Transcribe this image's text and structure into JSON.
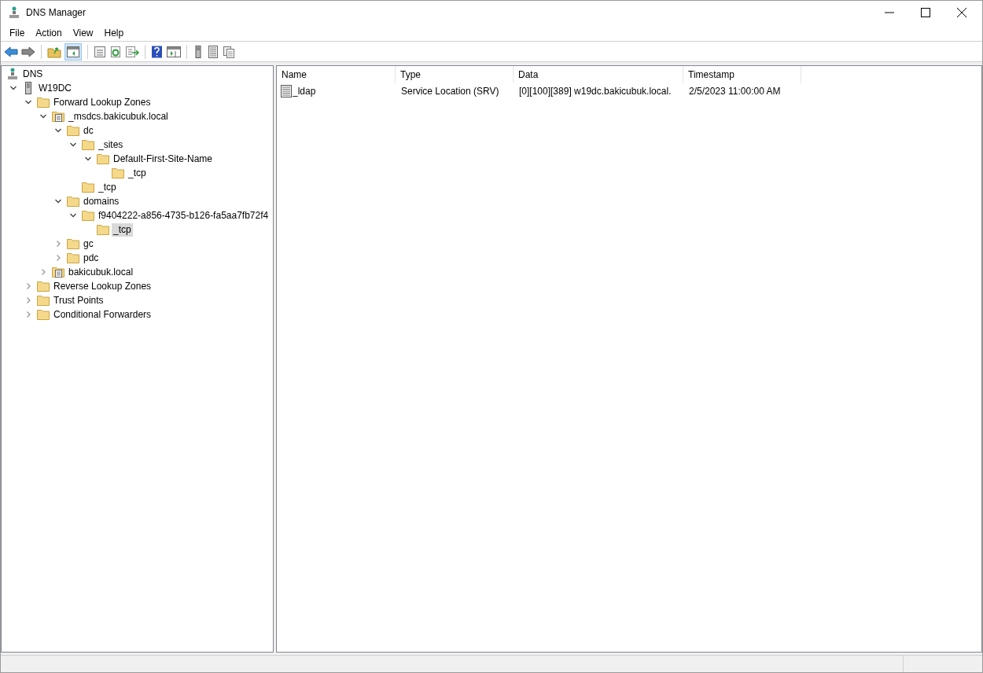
{
  "window": {
    "title": "DNS Manager"
  },
  "menu": [
    "File",
    "Action",
    "View",
    "Help"
  ],
  "tree": [
    {
      "label": "DNS",
      "kind": "dns",
      "selected": false,
      "children": [
        {
          "label": "W19DC",
          "kind": "server",
          "expanded": true,
          "selected": false,
          "children": [
            {
              "label": "Forward Lookup Zones",
              "kind": "folder",
              "expanded": true,
              "selected": false,
              "children": [
                {
                  "label": "_msdcs.bakicubuk.local",
                  "kind": "zone",
                  "expanded": true,
                  "selected": false,
                  "children": [
                    {
                      "label": "dc",
                      "kind": "folder",
                      "expanded": true,
                      "selected": false,
                      "children": [
                        {
                          "label": "_sites",
                          "kind": "folder",
                          "expanded": true,
                          "selected": false,
                          "children": [
                            {
                              "label": "Default-First-Site-Name",
                              "kind": "folder",
                              "expanded": true,
                              "selected": false,
                              "children": [
                                {
                                  "label": "_tcp",
                                  "kind": "folder",
                                  "selected": false
                                }
                              ]
                            }
                          ]
                        },
                        {
                          "label": "_tcp",
                          "kind": "folder",
                          "selected": false
                        }
                      ]
                    },
                    {
                      "label": "domains",
                      "kind": "folder",
                      "expanded": true,
                      "selected": false,
                      "children": [
                        {
                          "label": "f9404222-a856-4735-b126-fa5aa7fb72f4",
                          "kind": "folder",
                          "expanded": true,
                          "selected": false,
                          "children": [
                            {
                              "label": "_tcp",
                              "kind": "folder",
                              "selected": true
                            }
                          ]
                        }
                      ]
                    },
                    {
                      "label": "gc",
                      "kind": "folder",
                      "expanded": false,
                      "selected": false
                    },
                    {
                      "label": "pdc",
                      "kind": "folder",
                      "expanded": false,
                      "selected": false
                    }
                  ]
                },
                {
                  "label": "bakicubuk.local",
                  "kind": "zone",
                  "expanded": false,
                  "selected": false
                }
              ]
            },
            {
              "label": "Reverse Lookup Zones",
              "kind": "folder",
              "expanded": false,
              "selected": false
            },
            {
              "label": "Trust Points",
              "kind": "folder",
              "expanded": false,
              "selected": false
            },
            {
              "label": "Conditional Forwarders",
              "kind": "folder",
              "expanded": false,
              "selected": false
            }
          ]
        }
      ]
    }
  ],
  "table": {
    "columns": [
      "Name",
      "Type",
      "Data",
      "Timestamp"
    ],
    "rows": [
      {
        "cells": [
          "_ldap",
          "Service Location (SRV)",
          "[0][100][389] w19dc.bakicubuk.local.",
          "2/5/2023 11:00:00 AM"
        ],
        "selected": false
      }
    ]
  }
}
